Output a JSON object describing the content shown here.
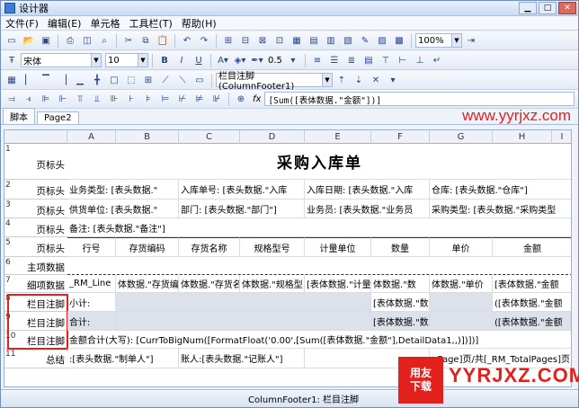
{
  "window": {
    "title": "设计器",
    "close_symbol": "✕"
  },
  "menu": [
    "文件(F)",
    "编辑(E)",
    "单元格",
    "工具栏(T)",
    "帮助(H)"
  ],
  "toolbar2": {
    "font": "宋体",
    "size": "10",
    "bold": "B",
    "italic": "I",
    "underline": "U",
    "line_width": "0.5",
    "band_select": "栏目注脚 (ColumnFooter1)",
    "fx": "fx",
    "formula": "[Sum([表体数据.\"金额\"])]"
  },
  "zoom": "100%",
  "tabs": [
    "脚本",
    "Page2"
  ],
  "columns": [
    "A",
    "B",
    "C",
    "D",
    "E",
    "F",
    "G",
    "H",
    "I"
  ],
  "rows": [
    {
      "num": "1",
      "band": "页标头"
    },
    {
      "num": "2",
      "band": "页标头"
    },
    {
      "num": "3",
      "band": "页标头"
    },
    {
      "num": "4",
      "band": "页标头"
    },
    {
      "num": "5",
      "band": "页标头"
    },
    {
      "num": "6",
      "band": "主项数据"
    },
    {
      "num": "7",
      "band": "细项数据"
    },
    {
      "num": "8",
      "band": "栏目注脚"
    },
    {
      "num": "9",
      "band": "栏目注脚"
    },
    {
      "num": "10",
      "band": "栏目注脚"
    },
    {
      "num": "11",
      "band": "总结"
    }
  ],
  "content": {
    "title": "采购入库单",
    "r2": [
      "业务类型: [表头数据.\"",
      "入库单号: [表头数据.\"入库",
      "入库日期: [表头数据.\"入库",
      "仓库: [表头数据.\"仓库\"]"
    ],
    "r3": [
      "供货单位: [表头数据.\"",
      "部门: [表头数据.\"部门\"]",
      "业务员: [表头数据.\"业务员",
      "采购类型: [表头数据.\"采购类型"
    ],
    "r4": "备注: [表头数据.\"备注\"]",
    "r5": [
      "行号",
      "存货编码",
      "存货名称",
      "规格型号",
      "计量单位",
      "数量",
      "单价",
      "金额"
    ],
    "r7": [
      "_RM_Line",
      "体数据.\"存货编",
      "体数据.\"存货名",
      "体数据.\"规格型",
      "[表体数据.\"计量单",
      "体数据.\"数",
      "体数据.\"单价",
      "[表体数据.\"金额"
    ],
    "r8": [
      "小计:",
      "[表体数据.\"数",
      "([表体数据.\"金额"
    ],
    "r9": [
      "合计:",
      "[表体数据.\"数",
      "([表体数据.\"金额"
    ],
    "r10": "金额合计(大写): [CurrToBigNum([FormatFloat('0.00',[Sum([表体数据.\"金额\"],DetailData1,,)])])]",
    "r11": [
      ":[表头数据.\"制单人\"]",
      "账人:[表头数据.\"记账人\"]",
      "Page]页/共[_RM_TotalPages]页"
    ]
  },
  "status": "ColumnFooter1: 栏目注脚",
  "watermark": {
    "url": "www.yyrjxz.com",
    "logo_top": "用友",
    "logo_bottom": "下载",
    "brand": "YYRJXZ.COM"
  }
}
